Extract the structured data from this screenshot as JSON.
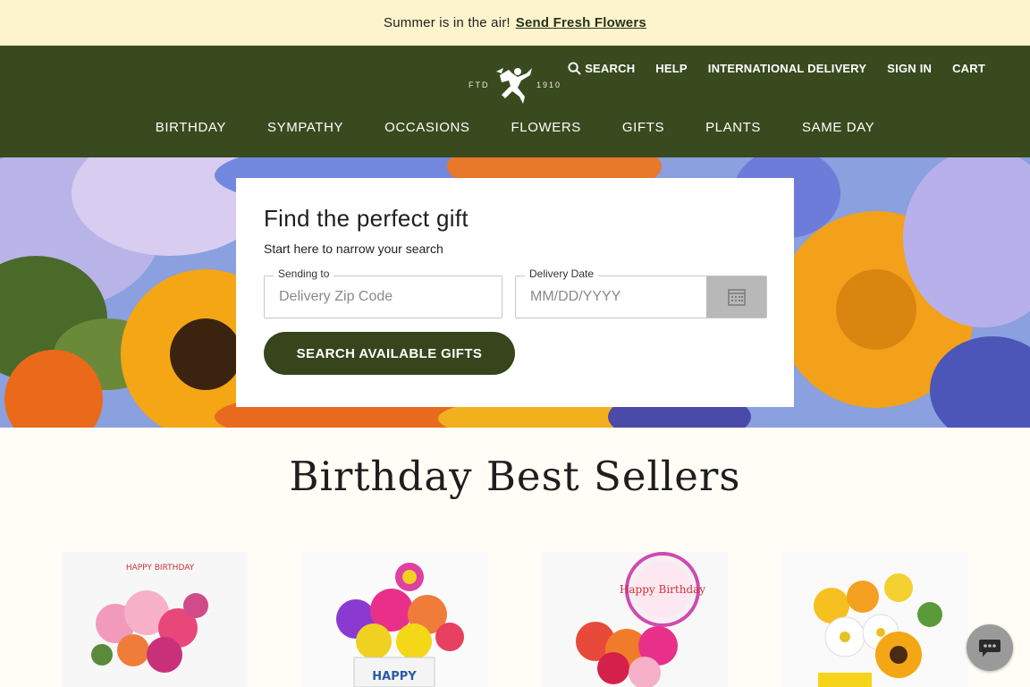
{
  "promo": {
    "message": "Summer is in the air!",
    "link": "Send Fresh Flowers"
  },
  "logo": {
    "left_text": "FTD",
    "right_text": "1910"
  },
  "utility_nav": {
    "search": "SEARCH",
    "help": "HELP",
    "international": "INTERNATIONAL DELIVERY",
    "sign_in": "SIGN IN",
    "cart": "CART"
  },
  "main_nav": [
    "BIRTHDAY",
    "SYMPATHY",
    "OCCASIONS",
    "FLOWERS",
    "GIFTS",
    "PLANTS",
    "SAME DAY"
  ],
  "finder": {
    "title": "Find the perfect gift",
    "subtitle": "Start here to narrow your search",
    "zip_label": "Sending to",
    "zip_placeholder": "Delivery Zip Code",
    "date_label": "Delivery Date",
    "date_placeholder": "MM/DD/YYYY",
    "button": "SEARCH AVAILABLE GIFTS"
  },
  "section_title": "Birthday Best Sellers",
  "products": [
    {
      "text": "HAPPY BIRTHDAY"
    },
    {
      "text": "HAPPY"
    },
    {
      "text": "Happy Birthday"
    },
    {
      "text": ""
    }
  ],
  "icons": {
    "search": "search-icon",
    "calendar": "calendar-icon",
    "chat": "chat-icon",
    "logo": "mercury-runner-logo"
  },
  "colors": {
    "promo_bg": "#fdf3cc",
    "nav_bg": "#3a4a1f",
    "button_bg": "#37441c",
    "page_bg": "#fffdf6"
  }
}
